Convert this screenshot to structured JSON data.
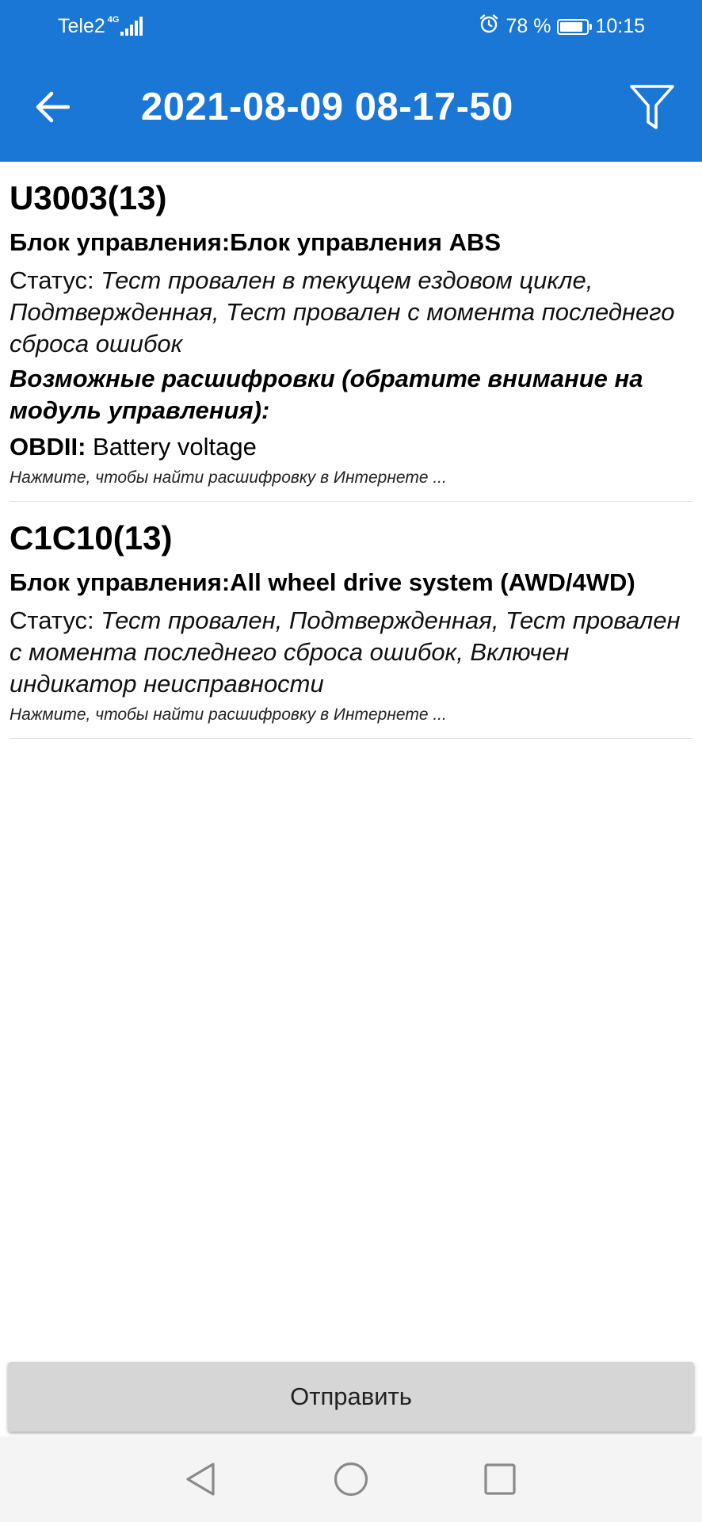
{
  "status_bar": {
    "carrier": "Tele2",
    "network": "4G",
    "battery_percent": "78 %",
    "battery_level": 0.78,
    "time": "10:15",
    "icons": [
      "signal-icon",
      "alarm-icon",
      "battery-icon"
    ]
  },
  "toolbar": {
    "title": "2021-08-09 08-17-50",
    "back_icon": "arrow-left-icon",
    "filter_icon": "filter-icon"
  },
  "errors": [
    {
      "code": "U3003(13)",
      "module": "Блок управления:Блок управления ABS",
      "status_label": "Статус: ",
      "status_value": "Тест провален в текущем ездовом цикле, Подтвержденная, Тест провален с момента последнего сброса ошибок",
      "decodings_header": "Возможные расшифровки (обратите внимание на модуль управления):",
      "obd_label": "OBDII:",
      "obd_value": " Battery voltage",
      "hint": "Нажмите, чтобы найти расшифровку в Интернете ..."
    },
    {
      "code": "C1C10(13)",
      "module": "Блок управления:All wheel drive system (AWD/4WD)",
      "status_label": "Статус: ",
      "status_value": "Тест провален, Подтвержденная, Тест провален с момента последнего сброса ошибок, Включен индикатор неисправности",
      "hint": "Нажмите, чтобы найти расшифровку в Интернете ..."
    }
  ],
  "send_button": {
    "label": "Отправить"
  },
  "nav_bar": {
    "icons": [
      "nav-back-icon",
      "nav-home-icon",
      "nav-recents-icon"
    ]
  },
  "colors": {
    "app_bar": "#1b77d5",
    "button": "#d6d6d6",
    "nav_bar": "#f4f4f4"
  }
}
